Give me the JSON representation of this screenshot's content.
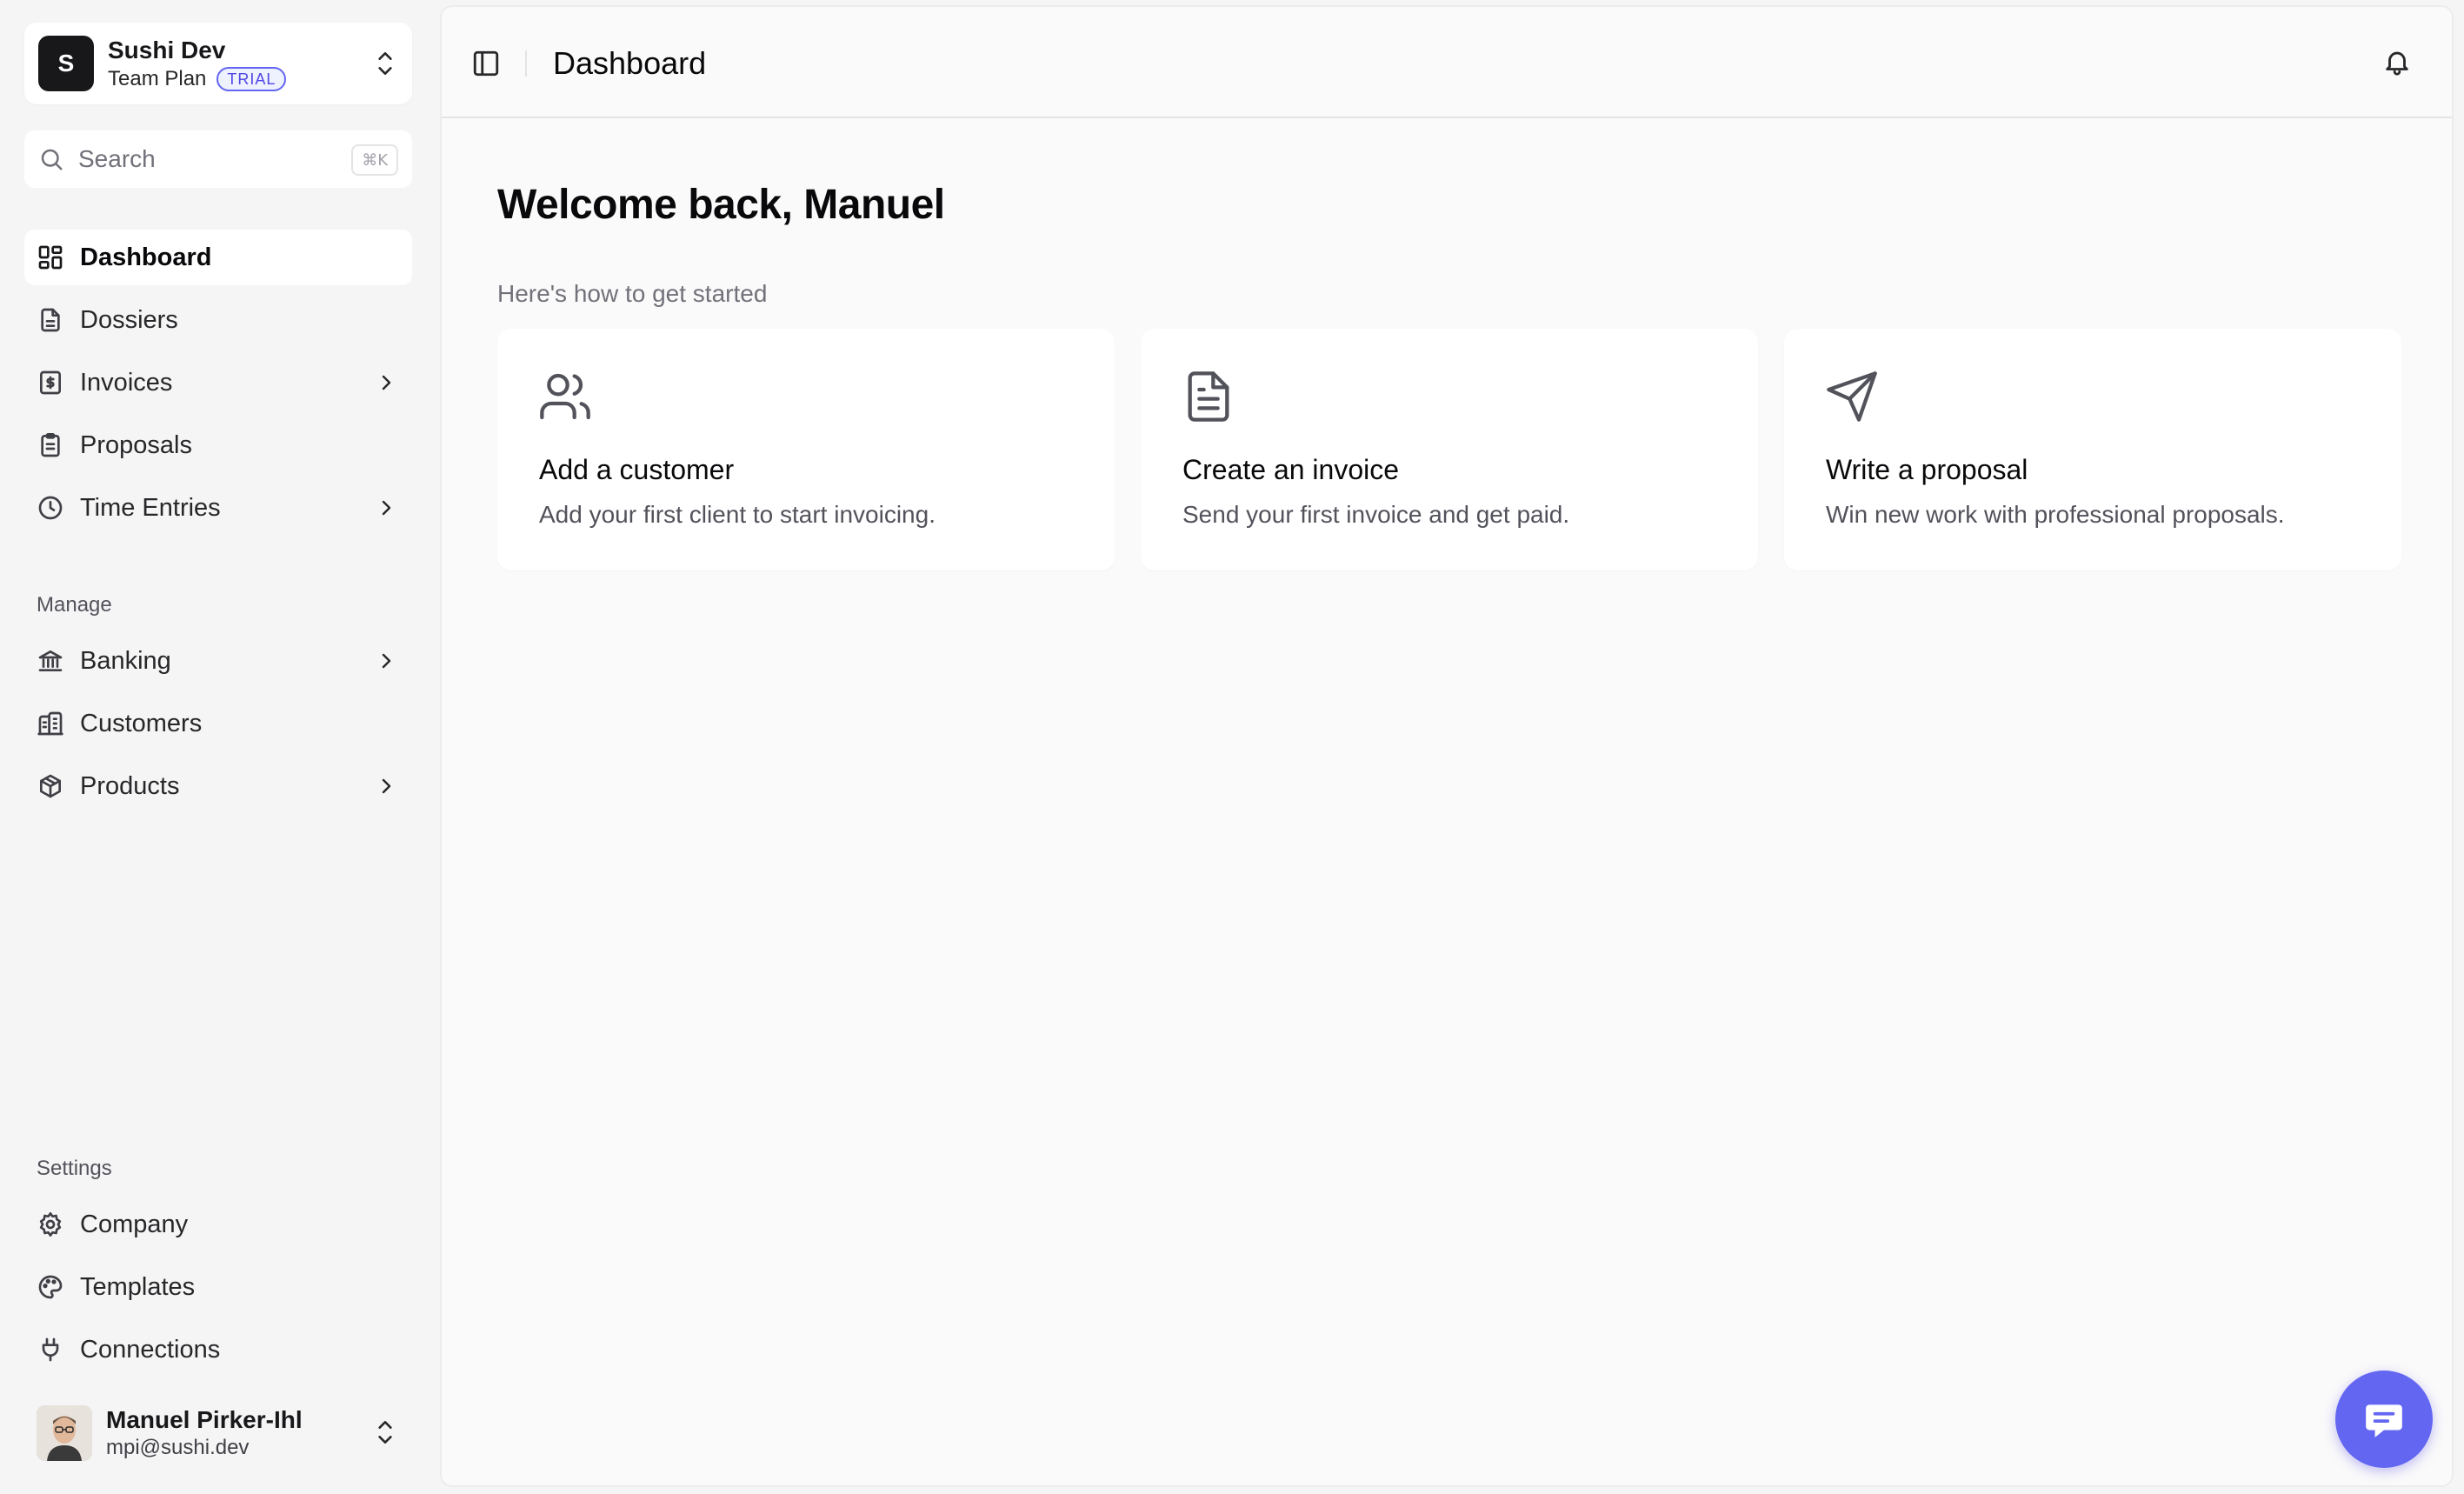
{
  "team": {
    "initial": "S",
    "name": "Sushi Dev",
    "plan": "Team Plan",
    "badge": "TRIAL"
  },
  "search": {
    "placeholder": "Search",
    "shortcut": "⌘K"
  },
  "nav": {
    "dashboard": "Dashboard",
    "dossiers": "Dossiers",
    "invoices": "Invoices",
    "proposals": "Proposals",
    "time_entries": "Time Entries"
  },
  "manage": {
    "label": "Manage",
    "banking": "Banking",
    "customers": "Customers",
    "products": "Products"
  },
  "settings": {
    "label": "Settings",
    "company": "Company",
    "templates": "Templates",
    "connections": "Connections"
  },
  "user": {
    "name": "Manuel Pirker-Ihl",
    "email": "mpi@sushi.dev"
  },
  "header": {
    "title": "Dashboard"
  },
  "main": {
    "welcome": "Welcome back, Manuel",
    "subhead": "Here's how to get started",
    "cards": [
      {
        "title": "Add a customer",
        "desc": "Add your first client to start invoicing.",
        "icon": "users-icon"
      },
      {
        "title": "Create an invoice",
        "desc": "Send your first invoice and get paid.",
        "icon": "file-text-icon"
      },
      {
        "title": "Write a proposal",
        "desc": "Win new work with professional proposals.",
        "icon": "send-icon"
      }
    ]
  },
  "colors": {
    "accent": "#6366f1",
    "text": "#18181b",
    "muted": "#71717a"
  }
}
